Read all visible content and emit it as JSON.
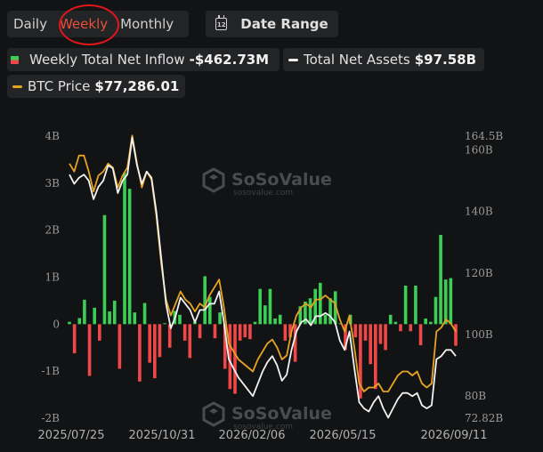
{
  "tabs": {
    "daily": "Daily",
    "weekly": "Weekly",
    "monthly": "Monthly"
  },
  "date_range": {
    "label": "Date Range",
    "icon": "calendar-icon",
    "icon_text": "12"
  },
  "legend": {
    "inflow": {
      "label": "Weekly Total Net Inflow",
      "value": "-$462.73M"
    },
    "assets": {
      "label": "Total Net Assets",
      "value": "$97.58B"
    },
    "price": {
      "label": "BTC Price",
      "value": "$77,286.01"
    }
  },
  "watermark": {
    "name": "SoSoValue",
    "url": "sosovalue.com"
  },
  "colors": {
    "inflow_pos": "#3ccf55",
    "inflow_neg": "#f04848",
    "assets_line": "#f2f2f2",
    "price_line": "#e5a223",
    "active_tab": "#e8503a",
    "annotation": "#e0161b"
  },
  "chart_data": {
    "type": "bar",
    "x_tick_labels": [
      "2025/07/25",
      "2025/10/31",
      "2026/02/06",
      "2026/05/15",
      "2026/09/11"
    ],
    "y_left_ticks": [
      "4B",
      "3B",
      "2B",
      "1B",
      "0",
      "-1B",
      "-2B"
    ],
    "y_left_range": [
      -2,
      4
    ],
    "y_right_ticks": [
      "164.5B",
      "160B",
      "140B",
      "120B",
      "100B",
      "80B",
      "72.82B"
    ],
    "y_right_range": [
      72.82,
      164.5
    ],
    "series": [
      {
        "name": "Weekly Total Net Inflow",
        "unit": "B USD",
        "values": [
          0.05,
          -0.62,
          0.13,
          0.52,
          -1.1,
          0.35,
          -0.35,
          2.32,
          0.27,
          0.5,
          -0.95,
          3.22,
          2.88,
          0.25,
          -1.22,
          0.45,
          -0.82,
          -1.15,
          -0.7,
          0.02,
          -0.5,
          0.28,
          0.2,
          -0.35,
          -0.72,
          0.05,
          -0.3,
          1.02,
          0.58,
          -0.3,
          0.25,
          -0.95,
          -1.38,
          -1.48,
          -0.35,
          -0.28,
          -0.32,
          0.05,
          0.75,
          0.4,
          0.75,
          0.12,
          0.2,
          -0.35,
          -0.28,
          -0.8,
          0.38,
          0.48,
          0.55,
          0.75,
          0.88,
          0.2,
          0.55,
          0.7,
          0.02,
          -0.55,
          0.2,
          -0.28,
          -1.58,
          -0.35,
          -0.85,
          -1.38,
          -0.42,
          -0.55,
          0.2,
          0.05,
          -0.15,
          0.82,
          -0.15,
          0.82,
          -0.45,
          0.12,
          0.05,
          0.58,
          1.9,
          0.95,
          0.98,
          -0.46
        ]
      },
      {
        "name": "Total Net Assets",
        "unit": "B USD",
        "values": [
          152,
          149,
          151,
          152,
          150,
          144,
          148,
          150,
          155,
          154,
          146,
          150,
          152,
          164,
          155,
          149,
          153,
          151,
          140,
          125,
          110,
          102,
          106,
          112,
          110,
          108,
          104,
          108,
          108,
          110,
          110,
          114,
          104,
          92,
          89,
          86,
          84,
          82,
          80,
          84,
          88,
          91,
          93,
          90,
          85,
          87,
          95,
          101,
          104,
          105,
          103,
          106,
          106,
          107,
          106,
          104,
          98,
          95,
          101,
          89,
          78,
          76,
          75,
          78,
          80,
          76,
          73,
          76,
          79,
          81,
          81,
          80,
          81,
          77,
          76,
          77,
          92,
          93,
          95,
          95,
          93
        ]
      },
      {
        "name": "BTC Price",
        "unit": "thousand USD",
        "values": [
          117,
          115,
          119,
          119,
          115,
          110,
          114,
          115,
          117,
          116,
          111,
          114,
          116,
          124,
          117,
          111,
          115,
          113,
          104,
          92,
          83,
          79,
          82,
          85,
          83,
          82,
          80,
          82,
          81,
          84,
          86,
          88,
          81,
          72,
          70,
          68,
          67,
          66,
          65,
          68,
          70,
          72,
          73,
          71,
          68,
          69,
          75,
          79,
          81,
          82,
          81,
          83,
          83,
          84,
          83,
          82,
          78,
          75,
          79,
          71,
          62,
          60,
          61,
          61,
          62,
          60,
          60,
          62,
          64,
          65,
          65,
          64,
          65,
          62,
          61,
          62,
          75,
          76,
          78,
          77,
          75
        ]
      }
    ]
  }
}
